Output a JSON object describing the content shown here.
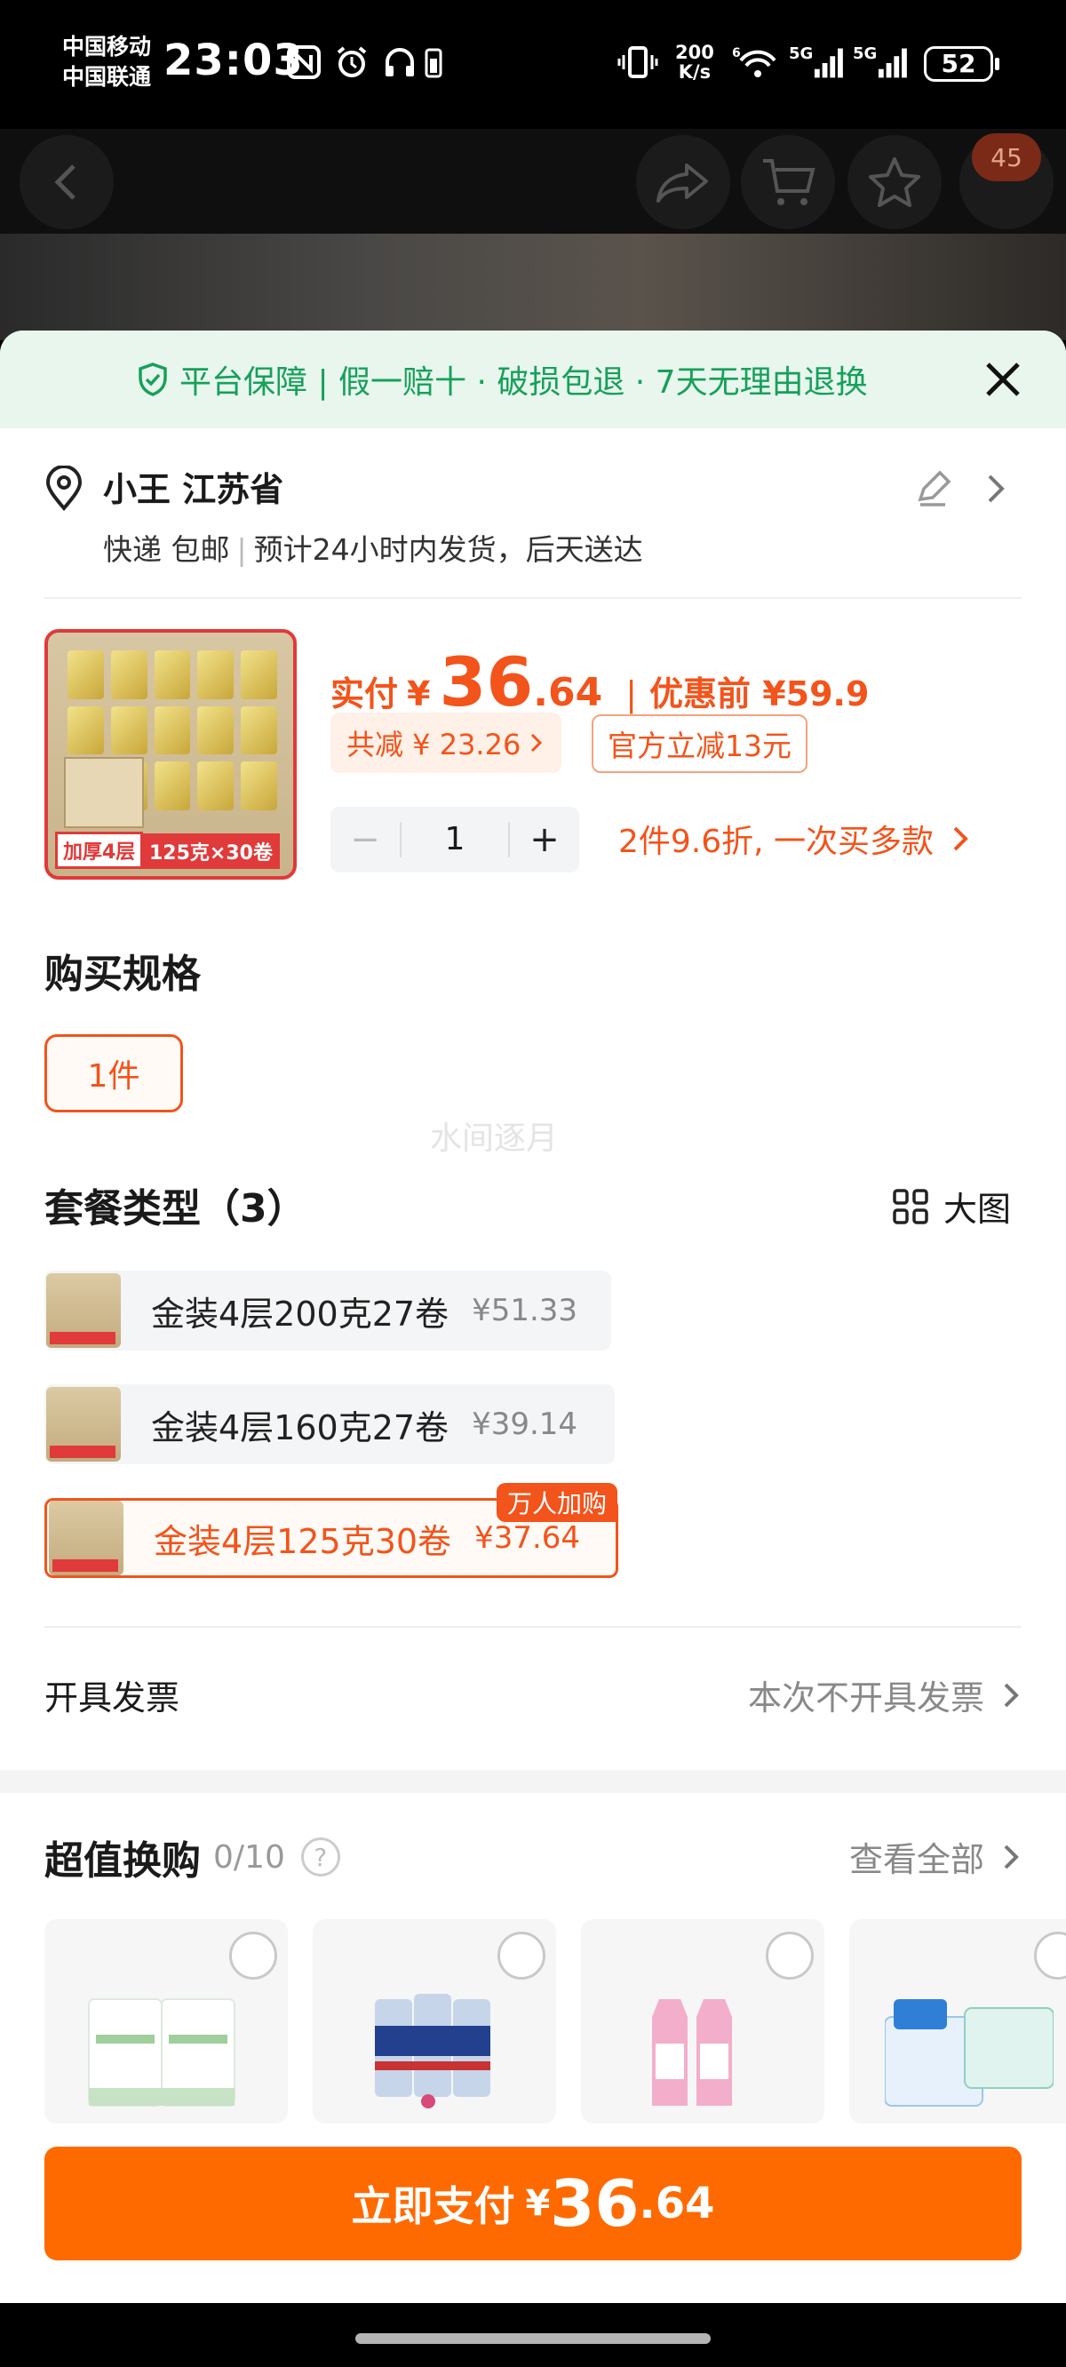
{
  "status": {
    "carrier1": "中国移动",
    "carrier2": "中国联通",
    "time": "23:03",
    "net_speed_value": "200",
    "net_speed_unit": "K/s",
    "net1": "5G",
    "net2": "5G",
    "battery": "52"
  },
  "header": {
    "cart_badge": "45"
  },
  "guarantee": {
    "text": "平台保障 | 假一赔十 · 破损包退 · 7天无理由退换"
  },
  "address": {
    "name": "小王 江苏省",
    "shipping": "快递 包邮",
    "eta": "预计24小时内发货，后天送达"
  },
  "product": {
    "tag_thick": "加厚4层",
    "tag_spec": "125克×30卷"
  },
  "price": {
    "pay_label": "实付",
    "currency": "¥",
    "pay_int": "36",
    "pay_dec": ".64",
    "before_label": "优惠前 ¥59.9",
    "discount": "共减 ¥ 23.26",
    "official_off": "官方立减13元"
  },
  "quantity": {
    "value": "1",
    "minus": "−",
    "plus": "+"
  },
  "multibuy": "2件9.6折, 一次买多款",
  "spec": {
    "title": "购买规格",
    "selected": "1件"
  },
  "watermark": "水间逐月",
  "packages": {
    "title": "套餐类型（3）",
    "big_view": "大图",
    "items": [
      {
        "name": "金装4层200克27卷",
        "price": "¥51.33"
      },
      {
        "name": "金装4层160克27卷",
        "price": "¥39.14"
      },
      {
        "name": "金装4层125克30卷",
        "price": "¥37.64",
        "badge": "万人加购"
      }
    ]
  },
  "invoice": {
    "label": "开具发票",
    "value": "本次不开具发票"
  },
  "swap": {
    "title": "超值换购",
    "count": "0/10",
    "help": "?",
    "see_all": "查看全部"
  },
  "pay_button": {
    "label": "立即支付",
    "currency": "¥",
    "amount_int": "36",
    "amount_dec": ".64"
  },
  "colors": {
    "accent": "#f2541b",
    "pay": "#ff6a00",
    "green": "#17a05a"
  }
}
